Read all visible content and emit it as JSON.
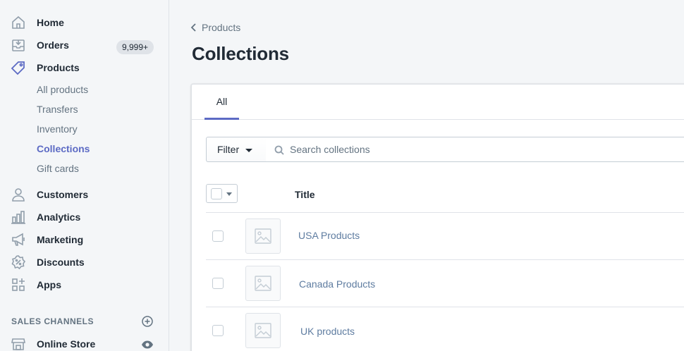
{
  "sidebar": {
    "nav": [
      {
        "label": "Home",
        "icon": "home-icon"
      },
      {
        "label": "Orders",
        "icon": "orders-icon",
        "badge": "9,999+"
      },
      {
        "label": "Products",
        "icon": "tag-icon"
      }
    ],
    "products_sub": [
      {
        "label": "All products",
        "active": false
      },
      {
        "label": "Transfers",
        "active": false
      },
      {
        "label": "Inventory",
        "active": false
      },
      {
        "label": "Collections",
        "active": true
      },
      {
        "label": "Gift cards",
        "active": false
      }
    ],
    "nav2": [
      {
        "label": "Customers",
        "icon": "person-icon"
      },
      {
        "label": "Analytics",
        "icon": "bar-chart-icon"
      },
      {
        "label": "Marketing",
        "icon": "megaphone-icon"
      },
      {
        "label": "Discounts",
        "icon": "discount-badge-icon"
      },
      {
        "label": "Apps",
        "icon": "apps-icon"
      }
    ],
    "sales_channels_header": "SALES CHANNELS",
    "online_store": "Online Store"
  },
  "main": {
    "breadcrumb": "Products",
    "title": "Collections",
    "tabs": [
      {
        "label": "All"
      }
    ],
    "filter_label": "Filter",
    "search_placeholder": "Search collections",
    "column_title": "Title",
    "rows": [
      {
        "name": "USA Products"
      },
      {
        "name": "Canada Products"
      },
      {
        "name": "UK products"
      }
    ]
  },
  "colors": {
    "accent": "#5c6ac4",
    "link": "#5e7ca0",
    "text": "#212b36",
    "subdued": "#637381",
    "border": "#dfe3e8",
    "background": "#f4f6f8"
  }
}
